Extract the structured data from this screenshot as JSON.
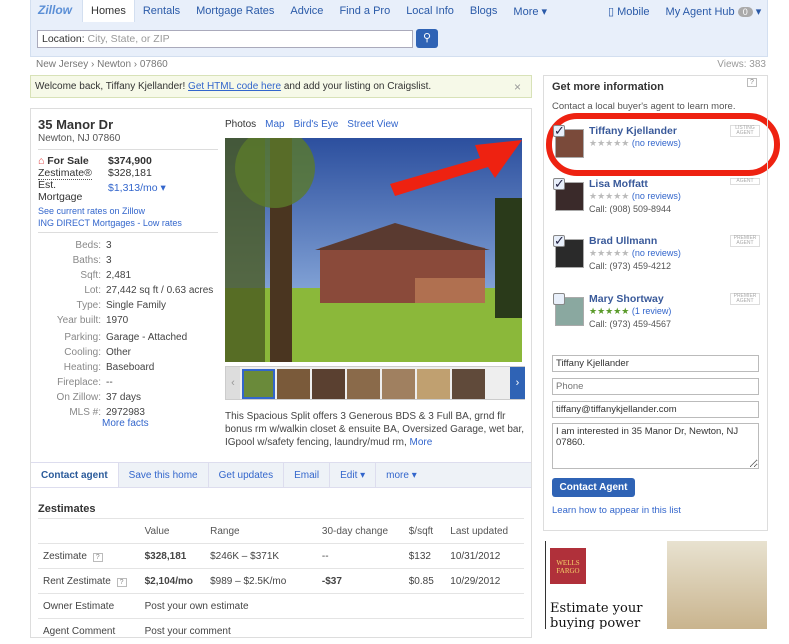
{
  "header": {
    "logo": "Zillow",
    "nav": [
      "Homes",
      "Rentals",
      "Mortgage Rates",
      "Advice",
      "Find a Pro",
      "Local Info",
      "Blogs",
      "More ▾"
    ],
    "mobile": "Mobile",
    "agent_hub": "My Agent Hub",
    "agent_hub_count": "0",
    "search_label": "Location:",
    "search_placeholder": "City, State, or ZIP"
  },
  "breadcrumb": "New Jersey › Newton › 07860",
  "views": "Views: 383",
  "welcome": {
    "text": "Welcome back, Tiffany Kjellander!",
    "link": "Get HTML code here",
    "rest": "and add your listing on Craigslist.",
    "close": "×"
  },
  "listing": {
    "address": "35 Manor Dr",
    "city": "Newton, NJ 07860",
    "status": "For Sale",
    "price": "$374,900",
    "zestimate_label": "Zestimate®",
    "zestimate": "$328,181",
    "mortgage_label": "Est. Mortgage",
    "mortgage": "$1,313/mo ▾",
    "rates_link": "See current rates on Zillow",
    "ing_link": "ING DIRECT Mortgages - Low rates",
    "facts": [
      [
        "Beds:",
        "3"
      ],
      [
        "Baths:",
        "3"
      ],
      [
        "Sqft:",
        "2,481"
      ],
      [
        "Lot:",
        "27,442 sq ft / 0.63 acres"
      ],
      [
        "Type:",
        "Single Family"
      ],
      [
        "Year built:",
        "1970"
      ]
    ],
    "facts2": [
      [
        "Parking:",
        "Garage - Attached"
      ],
      [
        "Cooling:",
        "Other"
      ],
      [
        "Heating:",
        "Baseboard"
      ],
      [
        "Fireplace:",
        "--"
      ],
      [
        "On Zillow:",
        "37 days"
      ],
      [
        "MLS #:",
        "2972983"
      ]
    ],
    "more_facts": "More facts",
    "media_tabs": [
      "Photos",
      "Map",
      "Bird's Eye",
      "Street View"
    ],
    "description": "This Spacious Split offers 3 Generous BDS & 3 Full BA, grnd flr bonus rm w/walkin closet & ensuite BA, Oversized Garage, wet bar, IGpool w/safety fencing, laundry/mud rm,",
    "more": "More"
  },
  "actions": [
    "Contact agent",
    "Save this home",
    "Get updates",
    "Email",
    "Edit ▾",
    "more ▾"
  ],
  "zestimates": {
    "title": "Zestimates",
    "headers": [
      "",
      "Value",
      "Range",
      "30-day change",
      "$/sqft",
      "Last updated"
    ],
    "rows": [
      [
        "Zestimate",
        "$328,181",
        "$246K – $371K",
        "--",
        "$132",
        "10/31/2012"
      ],
      [
        "Rent Zestimate",
        "$2,104/mo",
        "$989 – $2.5K/mo",
        "-$37",
        "$0.85",
        "10/29/2012"
      ]
    ],
    "owner_label": "Owner Estimate",
    "owner_link": "Post your own estimate",
    "agent_label": "Agent Comment",
    "agent_link": "Post your comment"
  },
  "contact": {
    "title": "Get more information",
    "help": "?",
    "subtitle": "Contact a local buyer's agent to learn more.",
    "agents": [
      {
        "name": "Tiffany Kjellander",
        "reviews": "(no reviews)",
        "call": "",
        "badge": "LISTING AGENT",
        "checked": true
      },
      {
        "name": "Lisa Moffatt",
        "reviews": "(no reviews)",
        "call": "Call: (908) 509-8944",
        "badge": "AGENT",
        "checked": true
      },
      {
        "name": "Brad Ullmann",
        "reviews": "(no reviews)",
        "call": "Call: (973) 459-4212",
        "badge": "PREMIER AGENT",
        "checked": true
      },
      {
        "name": "Mary Shortway",
        "reviews": "(1 review)",
        "call": "Call: (973) 459-4567",
        "badge": "PREMIER AGENT",
        "checked": false
      }
    ],
    "name_value": "Tiffany Kjellander",
    "phone_placeholder": "Phone",
    "email_value": "tiffany@tiffanykjellander.com",
    "message": "I am interested in 35 Manor Dr, Newton, NJ 07860.",
    "button": "Contact Agent",
    "learn": "Learn how to appear in this list"
  },
  "ad": {
    "brand": "WELLS FARGO",
    "headline": "Estimate your buying power"
  },
  "colors": {
    "annotation": "#ee2211",
    "accent": "#2f63b5",
    "orange": "#d07a1c"
  }
}
